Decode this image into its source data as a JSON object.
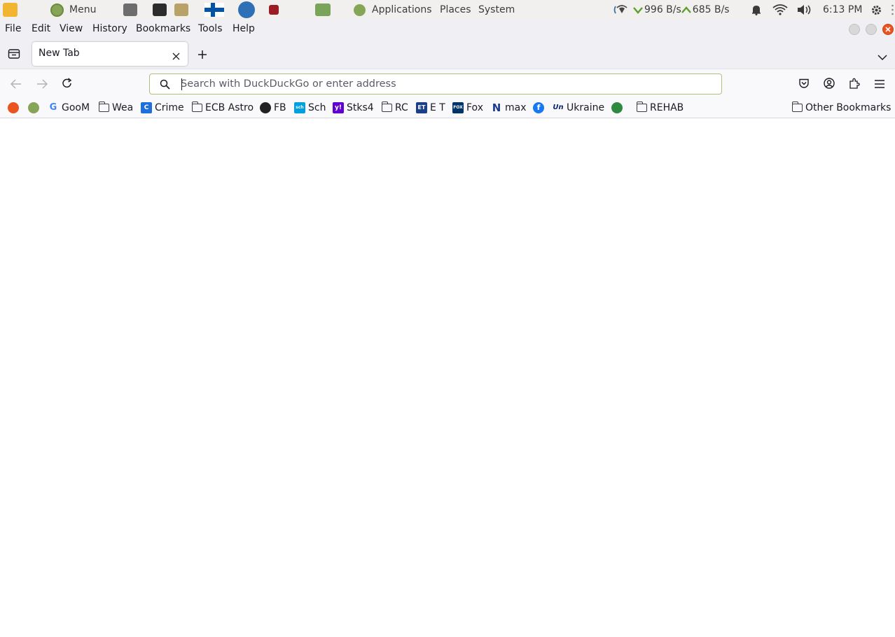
{
  "top_panel": {
    "menu_label": "Menu",
    "applications_label": "Applications",
    "places_label": "Places",
    "system_label": "System",
    "download_speed": "996 B/s",
    "upload_speed": "685 B/s",
    "clock": "6:13 PM"
  },
  "menubar": {
    "items": [
      "File",
      "Edit",
      "View",
      "History",
      "Bookmarks",
      "Tools",
      "Help"
    ]
  },
  "tabs": [
    {
      "title": "New Tab",
      "active": true
    }
  ],
  "urlbar": {
    "placeholder": "Search with DuckDuckGo or enter address",
    "value": ""
  },
  "bookmarks": {
    "items": [
      {
        "label": "",
        "icon": "ubuntu-icon"
      },
      {
        "label": "",
        "icon": "mint-icon"
      },
      {
        "label": "GooM",
        "icon": "google-icon"
      },
      {
        "label": "Wea",
        "icon": "folder-icon"
      },
      {
        "label": "Crime",
        "icon": "crime-favicon"
      },
      {
        "label": "ECB Astro",
        "icon": "folder-icon"
      },
      {
        "label": "FB",
        "icon": "horse-favicon"
      },
      {
        "label": "Sch",
        "icon": "schwab-favicon"
      },
      {
        "label": "Stks4",
        "icon": "yahoo-favicon"
      },
      {
        "label": "RC",
        "icon": "folder-icon"
      },
      {
        "label": "E T",
        "icon": "et-favicon"
      },
      {
        "label": "Fox",
        "icon": "fox-news-favicon"
      },
      {
        "label": "max",
        "icon": "newsmax-favicon"
      },
      {
        "label": "",
        "icon": "facebook-icon"
      },
      {
        "label": "Ukraine",
        "icon": "un-favicon"
      },
      {
        "label": "",
        "icon": "globe-favicon"
      },
      {
        "label": "REHAB",
        "icon": "folder-icon"
      }
    ],
    "other_label": "Other Bookmarks"
  },
  "colors": {
    "accent_close": "#e95420",
    "urlbar_border": "#a9c27a",
    "chrome_bg": "#f0f0f4"
  }
}
